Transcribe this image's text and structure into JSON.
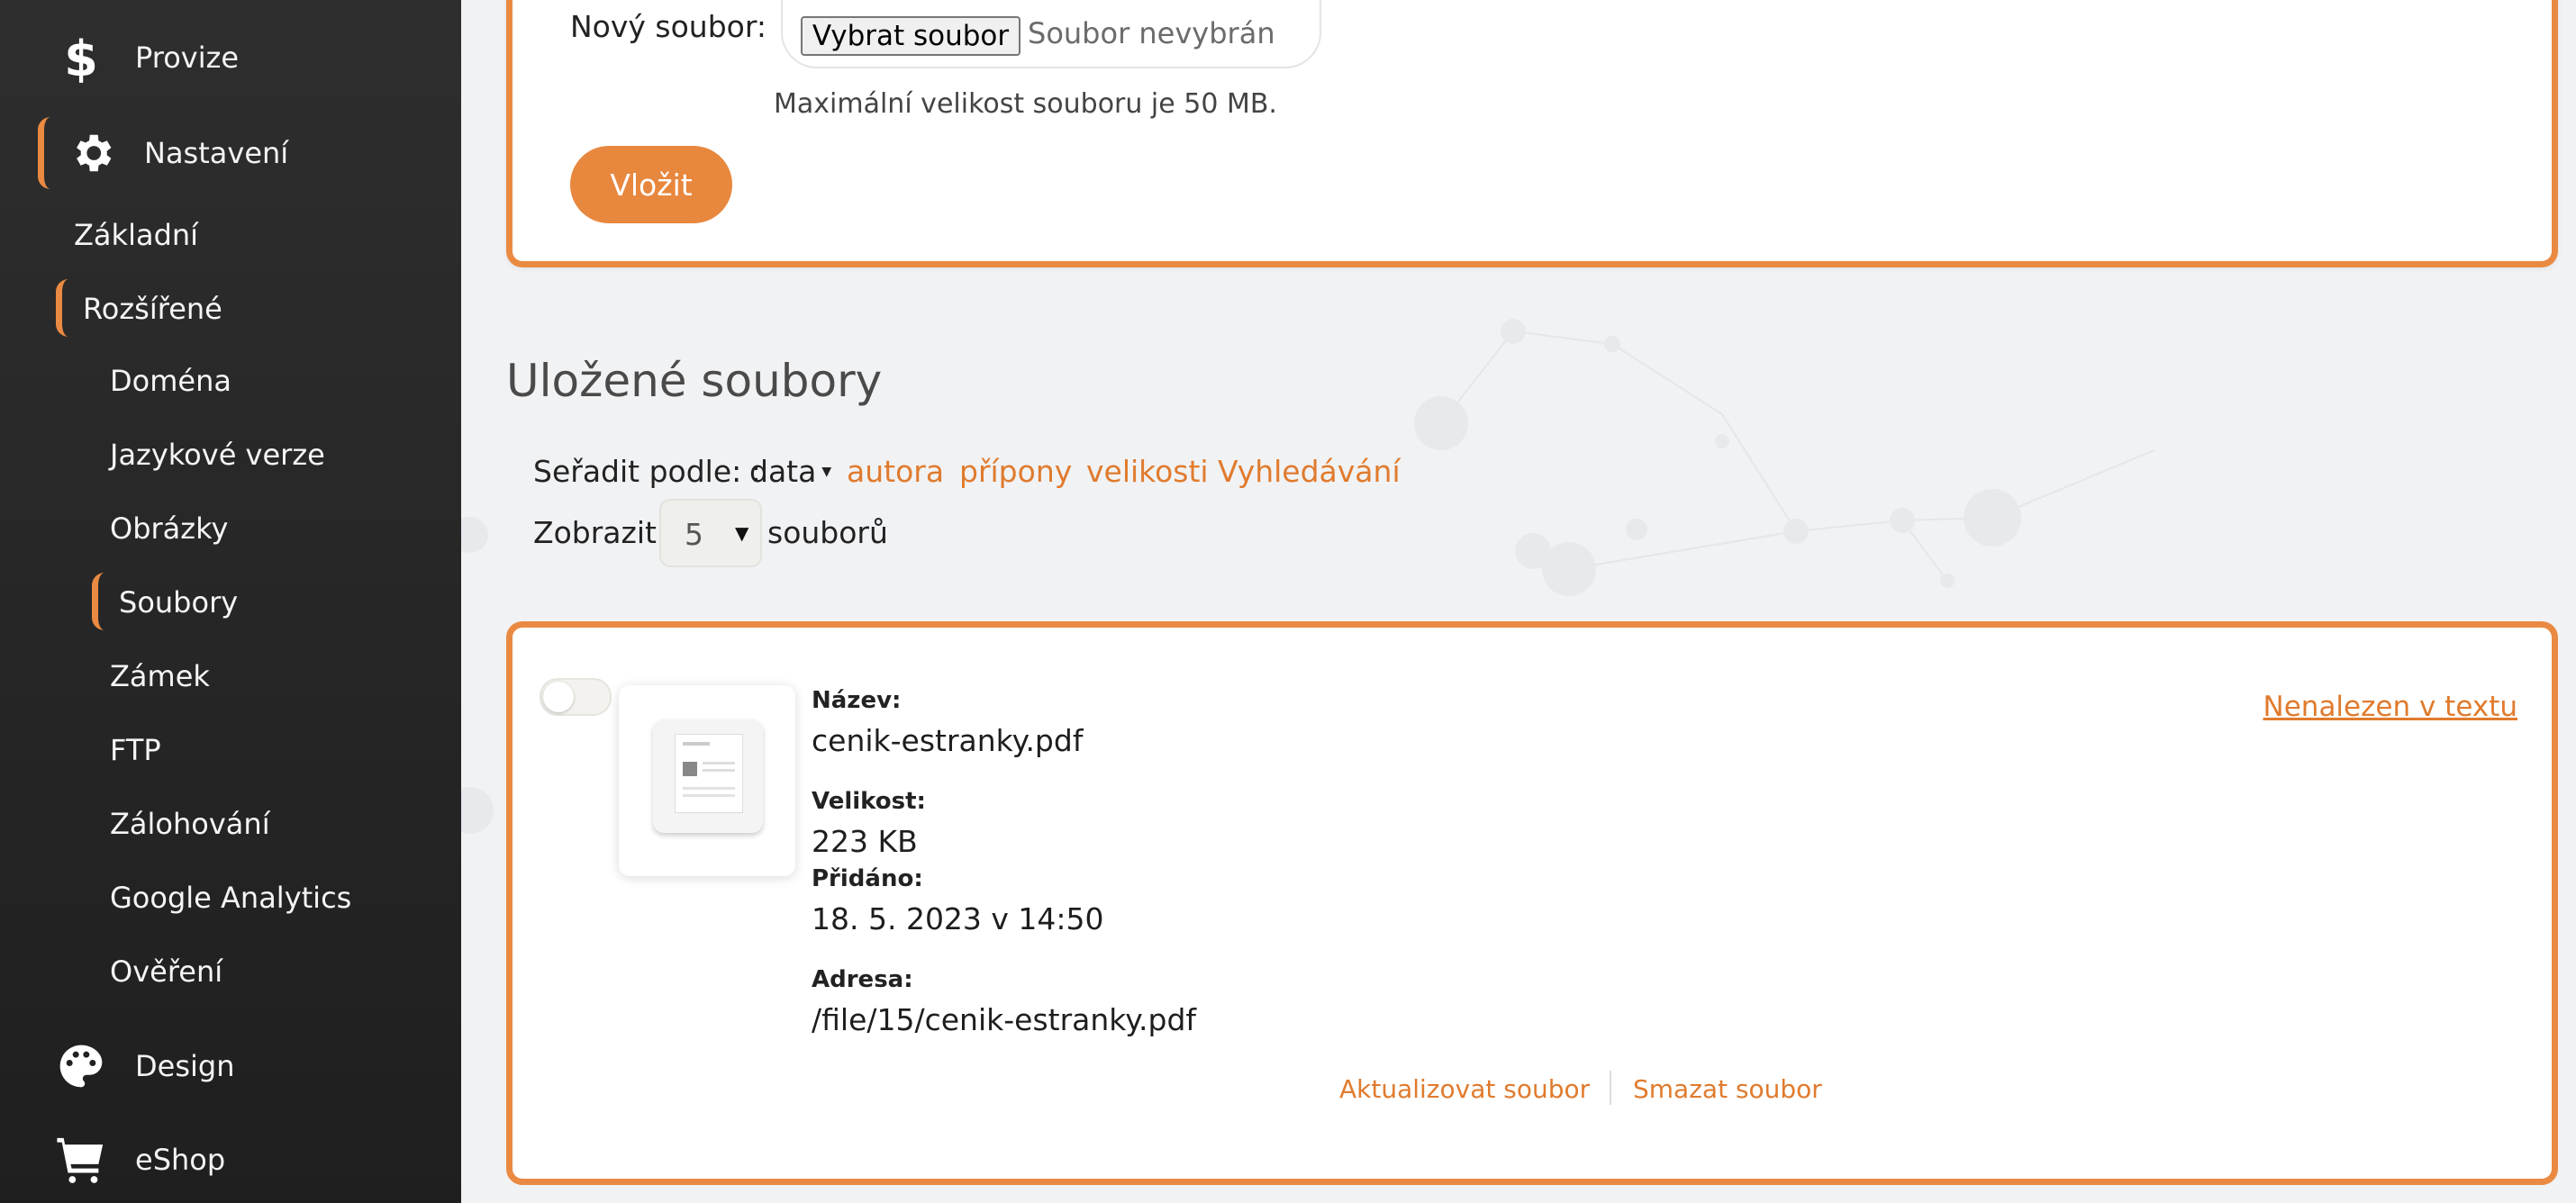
{
  "sidebar": {
    "top": [
      {
        "label": "Provize",
        "icon": "dollar-icon"
      },
      {
        "label": "Nastavení",
        "icon": "gear-icon"
      }
    ],
    "sub": [
      {
        "label": "Základní"
      },
      {
        "label": "Rozšířené"
      }
    ],
    "subsub": [
      {
        "label": "Doména"
      },
      {
        "label": "Jazykové verze"
      },
      {
        "label": "Obrázky"
      },
      {
        "label": "Soubory"
      },
      {
        "label": "Zámek"
      },
      {
        "label": "FTP"
      },
      {
        "label": "Zálohování"
      },
      {
        "label": "Google Analytics"
      },
      {
        "label": "Ověření"
      }
    ],
    "bottom": [
      {
        "label": "Design",
        "icon": "palette-icon"
      },
      {
        "label": "eShop",
        "icon": "cart-icon"
      }
    ]
  },
  "upload": {
    "label": "Nový soubor:",
    "choose_button": "Vybrat soubor",
    "no_file": "Soubor nevybrán",
    "hint": "Maximální velikost souboru je 50 MB.",
    "submit": "Vložit"
  },
  "saved": {
    "title": "Uložené soubory",
    "sort_label": "Seřadit podle: :",
    "sort_active": "data",
    "sort_options": [
      "autora",
      "přípony",
      "velikosti",
      "Vyhledávání"
    ],
    "show_label": "Zobrazit",
    "show_value": "5",
    "show_suffix": "souborů"
  },
  "file": {
    "name_label": "Název:",
    "name": "cenik-estranky.pdf",
    "size_label": "Velikost:",
    "size": "223 KB",
    "added_label": "Přidáno:",
    "added": "18. 5. 2023 v 14:50",
    "address_label": "Adresa:",
    "address": "/file/15/cenik-estranky.pdf",
    "not_found": "Nenalezen v textu",
    "update": "Aktualizovat soubor",
    "delete": "Smazat soubor"
  },
  "colors": {
    "accent": "#ea8a42",
    "link": "#e07b2e",
    "sidebar": "#262626"
  }
}
